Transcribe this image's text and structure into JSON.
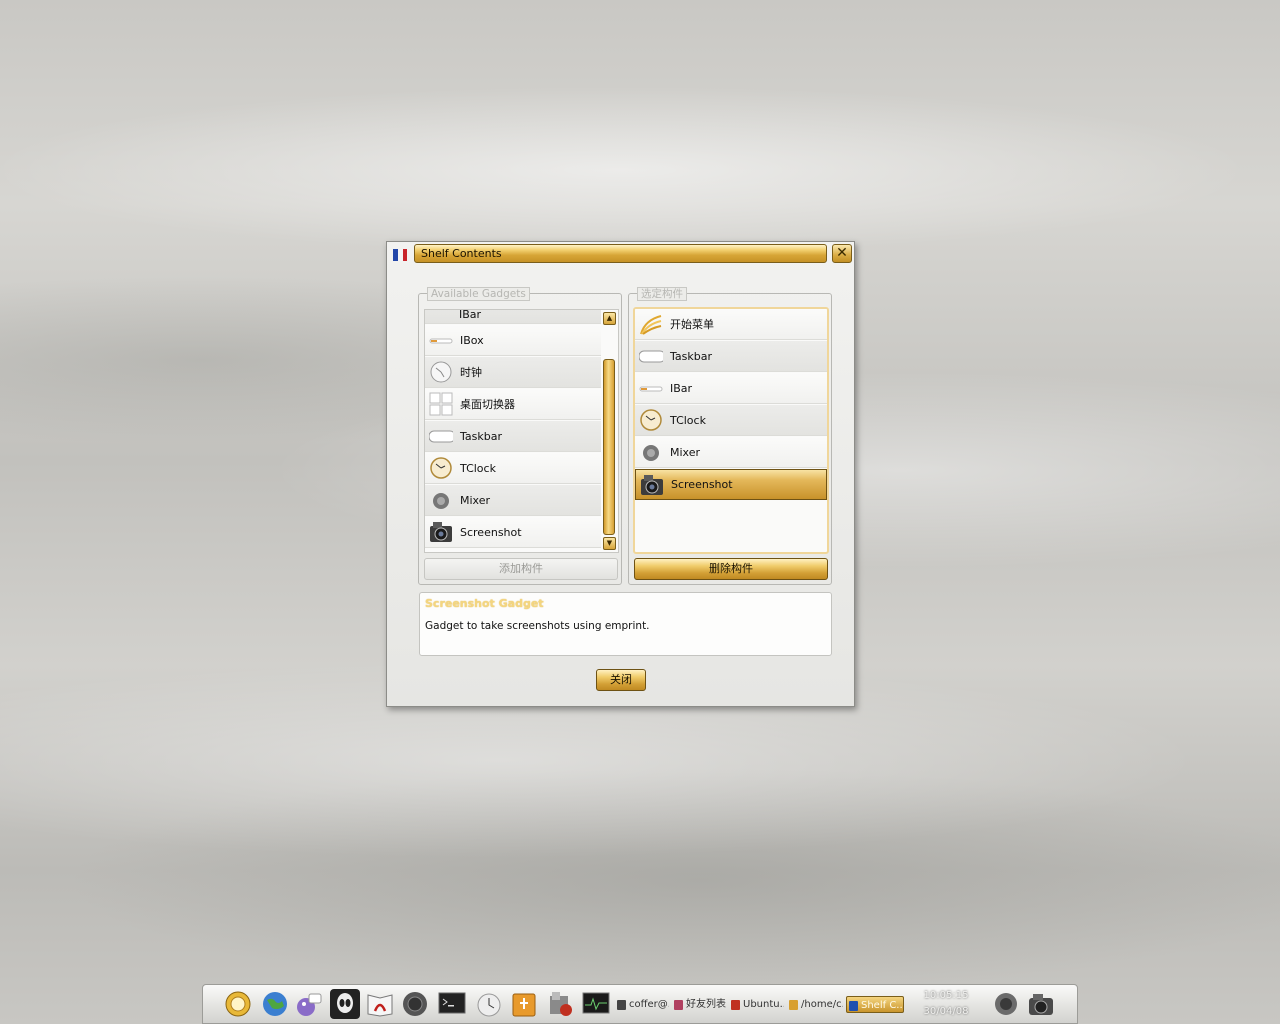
{
  "window": {
    "title": "Shelf Contents",
    "close_label": "✕"
  },
  "available": {
    "group_title": "Available Gadgets",
    "partial_top_label": "IBar",
    "items": [
      {
        "label": "IBox",
        "icon": "ibox-icon"
      },
      {
        "label": "时钟",
        "icon": "clock-icon"
      },
      {
        "label": "桌面切换器",
        "icon": "pager-icon"
      },
      {
        "label": "Taskbar",
        "icon": "taskbar-icon"
      },
      {
        "label": "TClock",
        "icon": "tclock-icon"
      },
      {
        "label": "Mixer",
        "icon": "mixer-icon"
      },
      {
        "label": "Screenshot",
        "icon": "camera-icon"
      }
    ],
    "add_button": "添加构件"
  },
  "selected": {
    "group_title": "选定构件",
    "items": [
      {
        "label": "开始菜单",
        "icon": "start-menu-icon"
      },
      {
        "label": "Taskbar",
        "icon": "taskbar-icon"
      },
      {
        "label": "IBar",
        "icon": "ibar-icon"
      },
      {
        "label": "TClock",
        "icon": "tclock-icon"
      },
      {
        "label": "Mixer",
        "icon": "mixer-icon"
      },
      {
        "label": "Screenshot",
        "icon": "camera-icon",
        "selected": true
      }
    ],
    "remove_button": "删除构件"
  },
  "description": {
    "title": "Screenshot Gadget",
    "text": "Gadget to take screenshots using emprint."
  },
  "close_button": "关闭",
  "taskbar": {
    "tasks": [
      {
        "label": "coffer@...",
        "color": "#444444"
      },
      {
        "label": "好友列表",
        "color": "#b04060"
      },
      {
        "label": "Ubuntu...",
        "color": "#c03020"
      },
      {
        "label": "/home/c...",
        "color": "#d8a030"
      },
      {
        "label": "Shelf C...",
        "color": "#2050b0",
        "active": true
      }
    ],
    "clock_time": "10:05:15",
    "clock_date": "30/04/08"
  },
  "colors": {
    "accent_gold": "#d7a536",
    "selection": "#c8922a"
  }
}
